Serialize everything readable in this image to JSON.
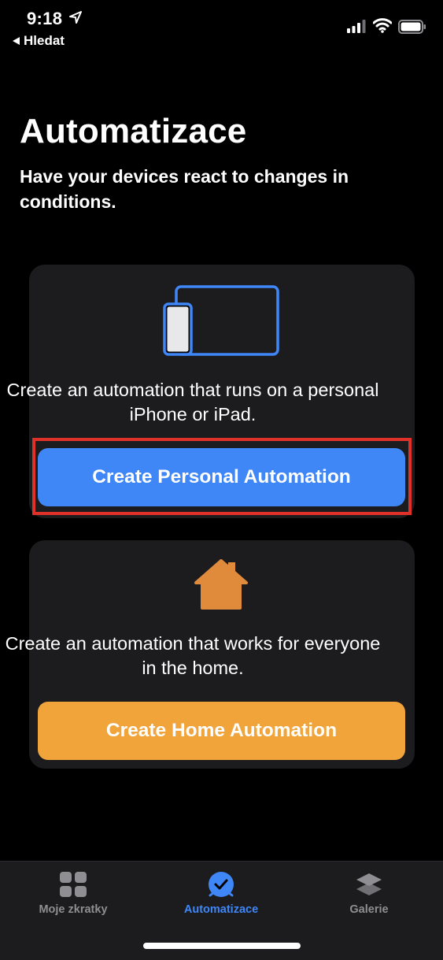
{
  "status_bar": {
    "time": "9:18",
    "back_label": "Hledat"
  },
  "header": {
    "title": "Automatizace",
    "subtitle": "Have your devices react to changes in conditions."
  },
  "cards": {
    "personal": {
      "icon": "iphone-ipad-icon",
      "description": "Create an automation that runs on a personal iPhone or iPad.",
      "button_label": "Create Personal Automation",
      "button_color": "#3f86f7",
      "highlighted": true,
      "highlight_color": "#e0302a"
    },
    "home": {
      "icon": "house-icon",
      "description": "Create an automation that works for everyone in the home.",
      "button_label": "Create Home Automation",
      "button_color": "#f0a43a"
    }
  },
  "tab_bar": {
    "tabs": [
      {
        "label": "Moje zkratky",
        "icon": "grid-icon",
        "active": false
      },
      {
        "label": "Automatizace",
        "icon": "automation-clock-icon",
        "active": true
      },
      {
        "label": "Galerie",
        "icon": "layers-icon",
        "active": false
      }
    ],
    "active_color": "#3f86f7",
    "inactive_color": "#8e8e93"
  }
}
